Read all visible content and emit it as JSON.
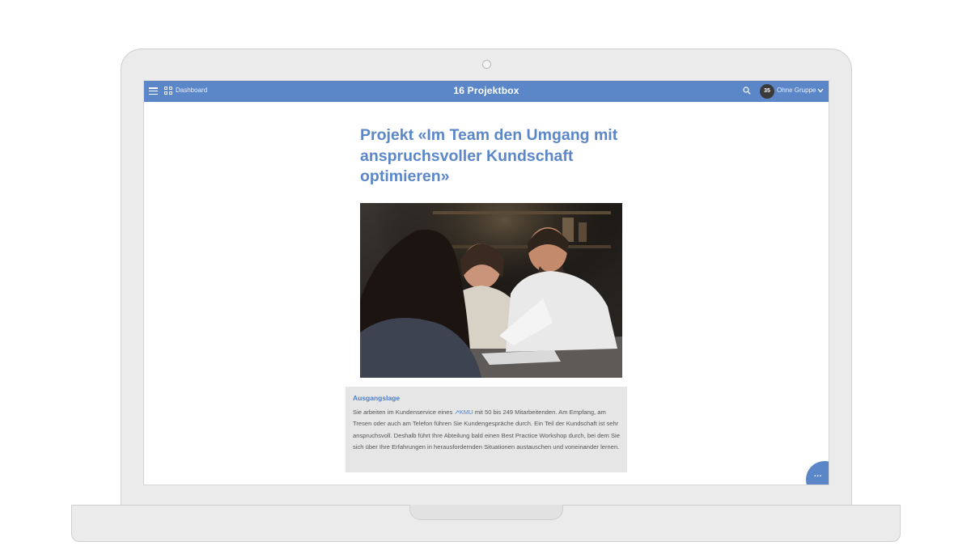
{
  "header": {
    "dashboard_label": "Dashboard",
    "title": "16  Projektbox",
    "badge_count": "35",
    "group_label": "Ohne Gruppe"
  },
  "icons": {
    "menu": "menu-icon",
    "dashboard": "grid-icon",
    "search": "search-icon",
    "dropdown": "chevron-down-icon",
    "more": "more-icon"
  },
  "main": {
    "title_line1": "Projekt «Im Team den Umgang mit",
    "title_line2": "anspruchsvoller Kundschaft",
    "title_line3": "optimieren»",
    "info": {
      "heading": "Ausgangslage",
      "text_before_link": "Sie arbeiten im Kundenservice eines ",
      "link_text": "↗KMU",
      "text_after_link": " mit 50 bis 249 Mitarbeitenden. Am Empfang, am Tresen oder auch am Telefon führen Sie Kundengespräche durch. Ein Teil der Kundschaft ist sehr anspruchsvoll. Deshalb führt Ihre Abteilung bald einen Best Practice Workshop durch, bei dem Sie sich über Ihre Erfahrungen in herausfordernden Situationen austauschen und voneinander lernen."
    }
  },
  "fab_label": "...",
  "colors": {
    "accent": "#5b87c9",
    "info_bg": "#e6e6e6",
    "frame": "#ebebeb"
  }
}
